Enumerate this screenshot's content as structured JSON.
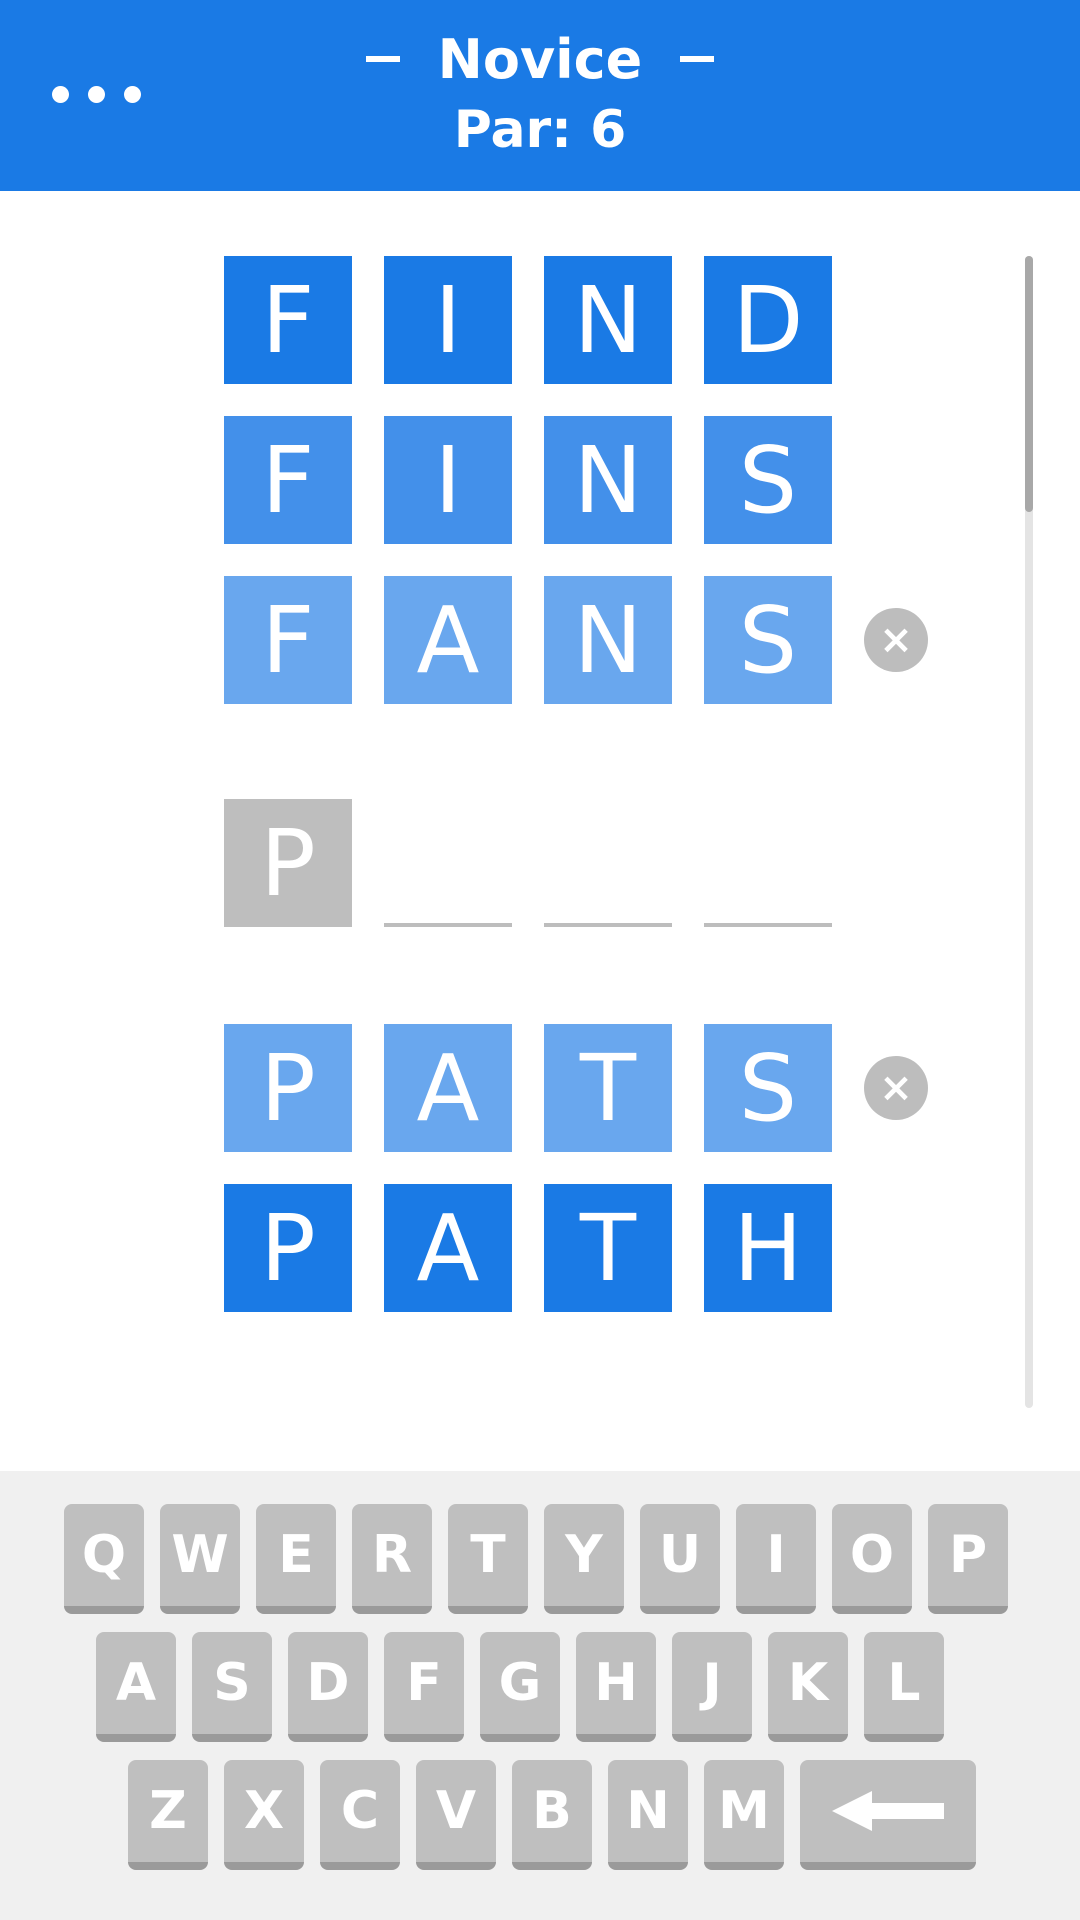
{
  "header": {
    "menu_icon": "more-horizontal-icon",
    "title": "Novice",
    "par": "Par: 6",
    "background": "#1a7ae5"
  },
  "board": {
    "rows": [
      {
        "letters": [
          "F",
          "I",
          "N",
          "D"
        ],
        "shade": "dark"
      },
      {
        "letters": [
          "F",
          "I",
          "N",
          "S"
        ],
        "shade": "mid"
      },
      {
        "letters": [
          "F",
          "A",
          "N",
          "S"
        ],
        "shade": "light",
        "removable": true
      },
      {
        "letters": [
          "P",
          "",
          "",
          ""
        ],
        "shade": "input"
      },
      {
        "letters": [
          "P",
          "A",
          "T",
          "S"
        ],
        "shade": "light",
        "removable": true
      },
      {
        "letters": [
          "P",
          "A",
          "T",
          "H"
        ],
        "shade": "dark"
      }
    ],
    "remove_icon": "close-circle-icon",
    "remove_symbol": "×",
    "colors": {
      "dark": "#1a7ae5",
      "mid": "#4390ea",
      "light": "#69a7ee",
      "input": "#bebebe"
    }
  },
  "keyboard": {
    "row1": [
      "Q",
      "W",
      "E",
      "R",
      "T",
      "Y",
      "U",
      "I",
      "O",
      "P"
    ],
    "row2": [
      "A",
      "S",
      "D",
      "F",
      "G",
      "H",
      "J",
      "K",
      "L"
    ],
    "row3": [
      "Z",
      "X",
      "C",
      "V",
      "B",
      "N",
      "M"
    ],
    "backspace_icon": "backspace-arrow-icon"
  }
}
